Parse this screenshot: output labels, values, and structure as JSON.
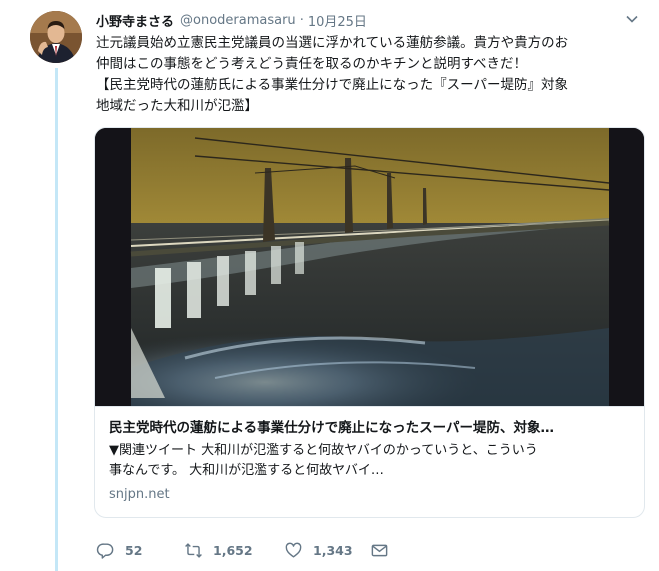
{
  "tweet": {
    "name": "小野寺まさる",
    "handle": "@onoderamasaru",
    "separator": "·",
    "date": "10月25日",
    "text_lines": [
      "辻元議員始め立憲民主党議員の当選に浮かれている蓮舫参議。貴方や貴方のお",
      "仲間はこの事態をどう考えどう責任を取るのかキチンと説明すべきだ！",
      "【民主党時代の蓮舫氏による事業仕分けで廃止になった『スーパー堤防』対象",
      "地域だった大和川が氾濫】"
    ]
  },
  "card": {
    "title": "民主党時代の蓮舫による事業仕分けで廃止になったスーパー堤防、対象…",
    "description_lines": [
      "▼関連ツイート 大和川が氾濫すると何故ヤバイのかっていうと、こういう",
      "事なんです。 大和川が氾濫すると何故ヤバイ…"
    ],
    "domain": "snjpn.net"
  },
  "actions": {
    "replies": "52",
    "retweets": "1,652",
    "likes": "1,343"
  },
  "colors": {
    "text": "#14171a",
    "muted": "#657786",
    "border": "#e1e8ed",
    "thread": "#c4e7f7"
  },
  "icons": {
    "caret": "chevron-down-icon",
    "reply": "reply-icon",
    "retweet": "retweet-icon",
    "like": "heart-icon",
    "dm": "envelope-icon"
  }
}
